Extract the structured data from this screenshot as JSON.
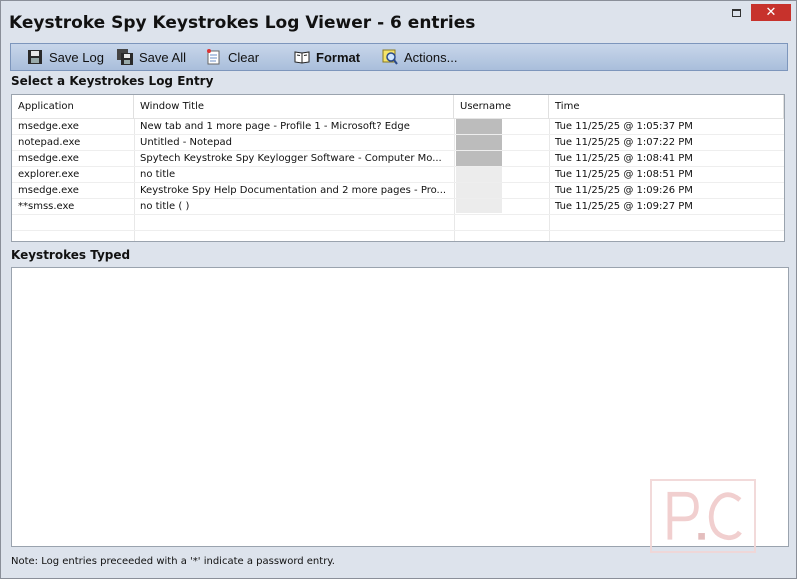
{
  "window": {
    "title": "Keystroke Spy Keystrokes Log Viewer - 6 entries",
    "close_glyph": "✕"
  },
  "toolbar": {
    "save_log": "Save Log",
    "save_all": "Save All",
    "clear": "Clear",
    "format": "Format",
    "actions": "Actions..."
  },
  "log_section": {
    "label": "Select a Keystrokes Log Entry",
    "columns": [
      "Application",
      "Window Title",
      "Username",
      "Time"
    ],
    "rows": [
      {
        "app": "msedge.exe",
        "title": "New tab and 1 more page - Profile 1 - Microsoft? Edge",
        "user": "",
        "time": "Tue  11/25/25 @ 1:05:37 PM"
      },
      {
        "app": "notepad.exe",
        "title": "Untitled - Notepad",
        "user": "",
        "time": "Tue  11/25/25 @ 1:07:22 PM"
      },
      {
        "app": "msedge.exe",
        "title": "Spytech Keystroke Spy Keylogger Software - Computer Mo...",
        "user": "",
        "time": "Tue  11/25/25 @ 1:08:41 PM"
      },
      {
        "app": "explorer.exe",
        "title": "no title",
        "user": "",
        "time": "Tue  11/25/25 @ 1:08:51 PM"
      },
      {
        "app": "msedge.exe",
        "title": "Keystroke Spy Help Documentation and 2 more pages - Pro...",
        "user": "",
        "time": "Tue  11/25/25 @ 1:09:26 PM"
      },
      {
        "app": "**smss.exe",
        "title": "no title ( )",
        "user": "",
        "time": "Tue  11/25/25 @ 1:09:27 PM"
      }
    ]
  },
  "keys_section": {
    "label": "Keystrokes Typed",
    "content": ""
  },
  "footer": {
    "note": "Note: Log entries preceeded with a '*' indicate a password entry."
  },
  "icons": {
    "save_log": "floppy-disk-icon",
    "save_all": "floppy-disks-icon",
    "clear": "clear-document-icon",
    "format": "open-book-icon",
    "actions": "magnifier-actions-icon"
  },
  "colors": {
    "close_button": "#c7322c",
    "toolbar_top": "#c8d6ea",
    "toolbar_bottom": "#a9bedb",
    "window_bg": "#dde3ec"
  }
}
